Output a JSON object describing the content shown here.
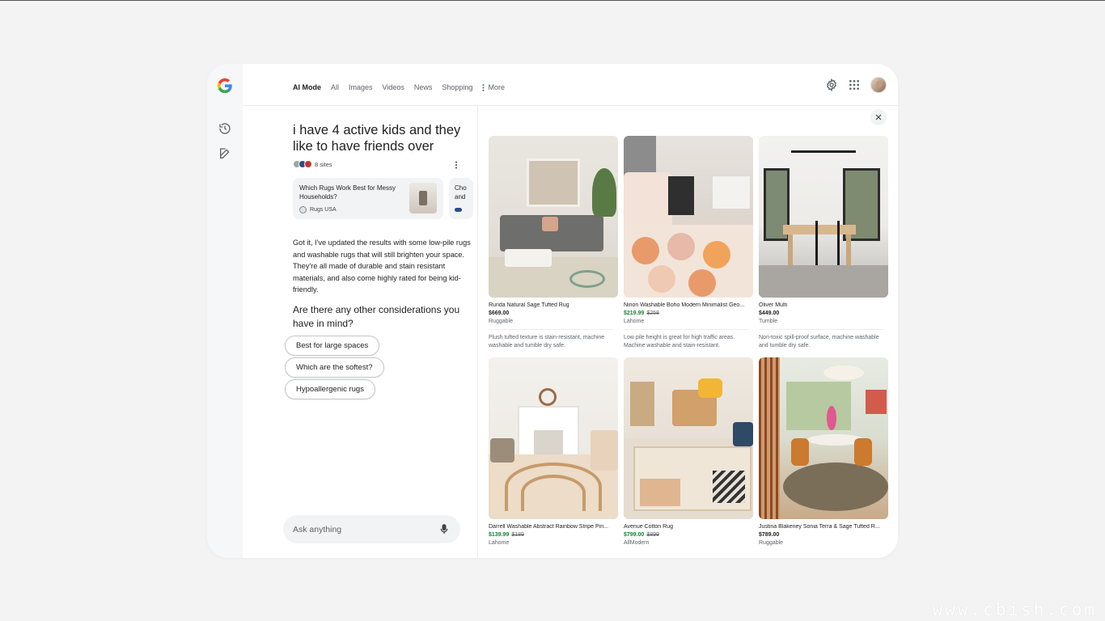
{
  "nav": {
    "tabs": [
      "AI Mode",
      "All",
      "Images",
      "Videos",
      "News",
      "Shopping"
    ],
    "more_label": "More"
  },
  "chat": {
    "title": "i have 4 active kids and they like to have friends over",
    "sites_label": "8 sites",
    "source_cards": [
      {
        "title": "Which Rugs Work Best for Messy Households?",
        "source": "Rugs USA"
      },
      {
        "title": "Cho\nand",
        "source": ""
      }
    ],
    "answer": "Got it, I've updated the results with some low-pile rugs and washable rugs that will still brighten your space. They're all made of durable and stain resistant materials, and also come highly rated for being kid-friendly.",
    "question": "Are there any other considerations you have in mind?",
    "chips": [
      "Best for large spaces",
      "Which are the softest?",
      "Hypoallergenic rugs"
    ],
    "ask_placeholder": "Ask anything"
  },
  "products": [
    {
      "name": "Runda Natural Sage Tufted Rug",
      "price": "$669.00",
      "old_price": "",
      "on_sale": false,
      "store": "Ruggable",
      "desc": "Plush tufted texture is stain-resistant, machine washable and tumble dry safe."
    },
    {
      "name": "Ninon Washable Boho Modern Minimalist Geo...",
      "price": "$219.99",
      "old_price": "$258",
      "on_sale": true,
      "store": "Lahome",
      "desc": "Low pile height is great for high traffic areas. Machine washable and stain-resistant."
    },
    {
      "name": "Oliver Multi",
      "price": "$449.00",
      "old_price": "",
      "on_sale": false,
      "store": "Tumble",
      "desc": "Non-toxic spill-proof surface, machine washable and tumble dry safe."
    },
    {
      "name": "Darrell Washable Abstract Rainbow Stripe Pin...",
      "price": "$139.99",
      "old_price": "$189",
      "on_sale": true,
      "store": "Lahome",
      "desc": ""
    },
    {
      "name": "Avenue Cotton Rug",
      "price": "$799.00",
      "old_price": "$899",
      "on_sale": true,
      "store": "AllModern",
      "desc": ""
    },
    {
      "name": "Justina Blakeney Sonia Terra & Sage Tufted R...",
      "price": "$789.00",
      "old_price": "",
      "on_sale": false,
      "store": "Ruggable",
      "desc": ""
    }
  ],
  "watermark": "www.cbish.com",
  "colors": {
    "sale_price": "#188038",
    "chip_border": "#c4c7c5",
    "panel": "#f1f3f4"
  }
}
